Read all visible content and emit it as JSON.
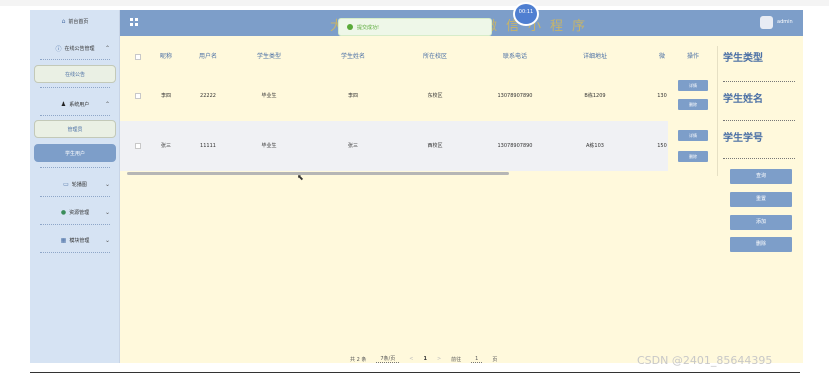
{
  "header": {
    "title": "大学生毕业求职微信小程序",
    "user": "admin",
    "badge": "00:11"
  },
  "toast": {
    "text": "提交成功!"
  },
  "sidebar": {
    "home": "前台首页",
    "groups": [
      {
        "label": "在线公告管理",
        "sub": [
          "在线公告"
        ]
      },
      {
        "label": "系统用户",
        "sub": [
          "管理员",
          "学生用户"
        ]
      },
      {
        "label": "轮播图"
      },
      {
        "label": "资源管理"
      },
      {
        "label": "模块管理"
      }
    ]
  },
  "table": {
    "headers": [
      "昵称",
      "用户名",
      "学生类型",
      "学生姓名",
      "所在校区",
      "联系电话",
      "详细地址",
      "微",
      "操作"
    ],
    "rows": [
      {
        "nickname": "李四",
        "username": "22222",
        "type": "毕业生",
        "name": "李四",
        "campus": "东校区",
        "phone": "13078907890",
        "address": "B栋1209",
        "wx": "130"
      },
      {
        "nickname": "张三",
        "username": "11111",
        "type": "毕业生",
        "name": "张三",
        "campus": "西校区",
        "phone": "13078907890",
        "address": "A栋103",
        "wx": "150"
      }
    ],
    "op_detail": "详情",
    "op_delete": "删除"
  },
  "search": {
    "labels": [
      "学生类型",
      "学生姓名",
      "学生学号"
    ],
    "buttons": [
      "查询",
      "重置",
      "添加",
      "删除"
    ]
  },
  "pager": {
    "total": "共 2 条",
    "page_size": "7条/页",
    "prev": "<",
    "current": "1",
    "next": ">",
    "goto": "前往",
    "goto_value": "1",
    "page_unit": "页"
  },
  "watermark": "CSDN @2401_85644395",
  "colors": {
    "primary": "#7d9ec9",
    "sidebar_bg": "#d6e3f3",
    "content_bg": "#fff9dc",
    "title_gold": "#c6b46a"
  }
}
